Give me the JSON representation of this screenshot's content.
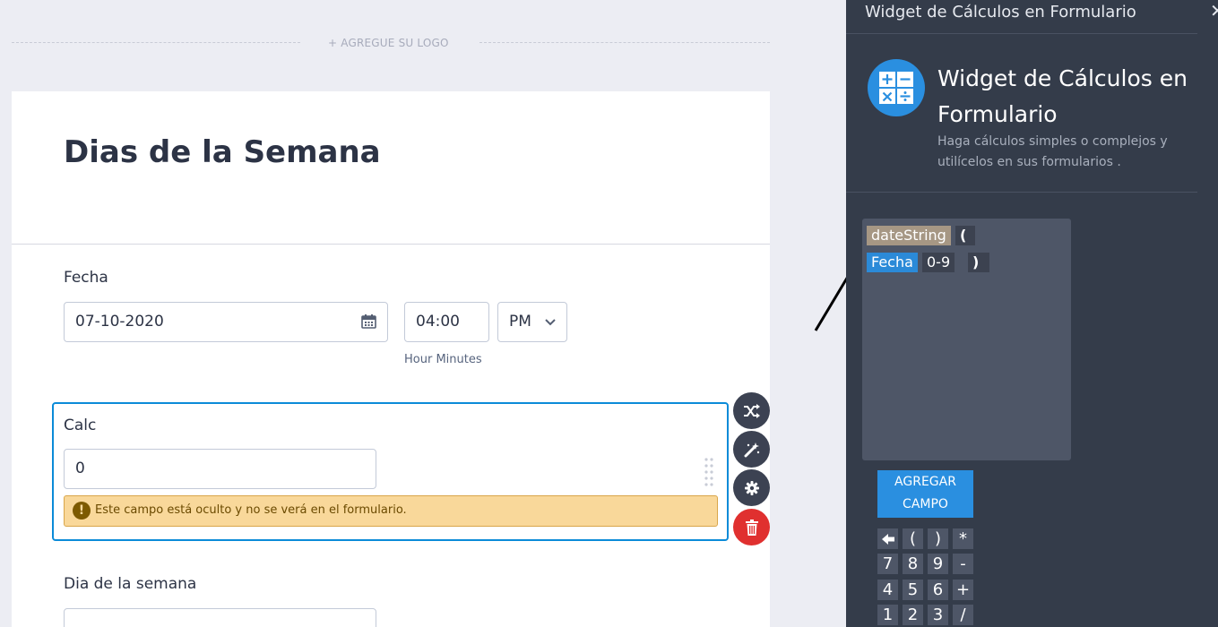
{
  "logo": {
    "add_logo": "+ AGREGUE SU LOGO"
  },
  "form": {
    "title": "Dias de la Semana",
    "fecha": {
      "label": "Fecha",
      "date_value": "07-10-2020",
      "time_value": "04:00",
      "ampm_value": "PM",
      "time_sublabel": "Hour Minutes"
    },
    "calc": {
      "label": "Calc",
      "value": "0",
      "warning": "Este campo está oculto y no se verá en el formulario."
    },
    "dia": {
      "label": "Dia de la semana"
    }
  },
  "panel": {
    "title": "Widget de Cálculos en Formulario",
    "close": "✕",
    "widget_name": "Widget de Cálculos en Formulario",
    "widget_desc": "Haga cálculos simples o complejos y utilícelos en sus formularios .",
    "tokens": {
      "func": "dateString",
      "open_paren": "(",
      "field": "Fecha",
      "format": "0-9",
      "close_paren": ")"
    },
    "add_field_button": "AGREGAR CAMPO",
    "keypad": [
      "🡐",
      "(",
      ")",
      "*",
      "7",
      "8",
      "9",
      "-",
      "4",
      "5",
      "6",
      "+",
      "1",
      "2",
      "3",
      "/"
    ]
  },
  "colors": {
    "accent_blue": "#2a8fe0",
    "panel_bg": "#343c4a",
    "selection_border": "#0b8bd8",
    "delete_red": "#e0302f",
    "warning_bg": "#f9d89a"
  },
  "icons": [
    "calendar-icon",
    "chevron-down-icon",
    "shuffle-icon",
    "magic-wand-icon",
    "gear-icon",
    "trash-icon",
    "calculator-icon",
    "close-icon",
    "warning-icon",
    "arrow-left-icon"
  ]
}
